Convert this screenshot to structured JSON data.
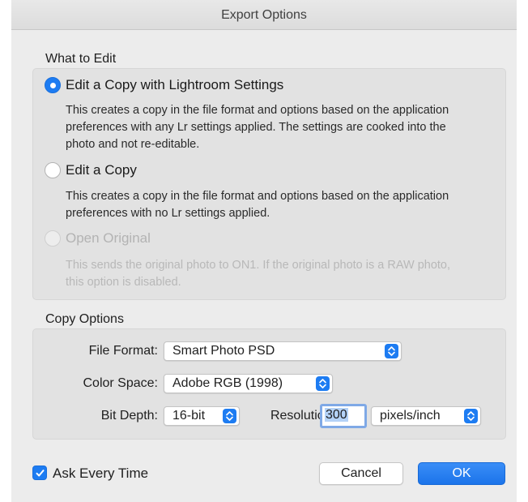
{
  "window": {
    "title": "Export Options"
  },
  "what_to_edit": {
    "heading": "What to Edit",
    "options": [
      {
        "label": "Edit a Copy with Lightroom Settings",
        "description": [
          "This creates a copy in the file format and options based on the application",
          "preferences with any Lr settings applied. The settings are cooked into the",
          "photo and not re-editable."
        ],
        "selected": true,
        "enabled": true
      },
      {
        "label": "Edit a Copy",
        "description": [
          "This creates a copy in the file format and options based on the application",
          "preferences with no Lr settings applied."
        ],
        "selected": false,
        "enabled": true
      },
      {
        "label": "Open Original",
        "description": [
          "This sends the original photo to ON1. If the original photo is a RAW photo,",
          "this option is disabled."
        ],
        "selected": false,
        "enabled": false
      }
    ]
  },
  "copy_options": {
    "heading": "Copy Options",
    "file_format": {
      "label": "File Format:",
      "value": "Smart Photo PSD"
    },
    "color_space": {
      "label": "Color Space:",
      "value": "Adobe RGB (1998)"
    },
    "bit_depth": {
      "label": "Bit Depth:",
      "value": "16-bit"
    },
    "resolution": {
      "label": "Resolution:",
      "value": "300",
      "unit": "pixels/inch"
    }
  },
  "footer": {
    "ask_every_time": {
      "label": "Ask Every Time",
      "checked": true
    },
    "cancel_label": "Cancel",
    "ok_label": "OK"
  },
  "colors": {
    "accent": "#1d7cf2",
    "panel": "#e2e2e2",
    "window": "#ececec"
  }
}
